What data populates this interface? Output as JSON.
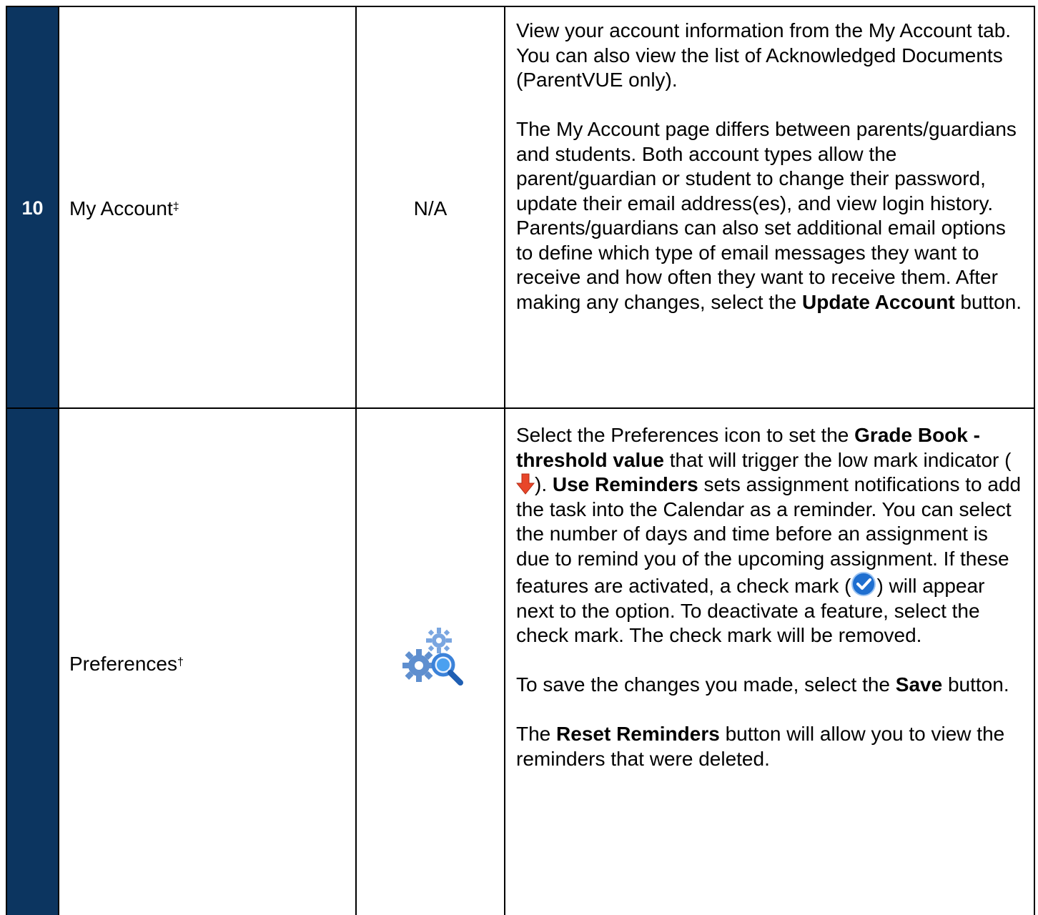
{
  "rows": [
    {
      "number": "10",
      "name": "My Account",
      "name_mark": "‡",
      "icon_text": "N/A",
      "paragraphs": [
        [
          "View your account information from the My Account tab.  You can also view the list of Acknowledged Documents (ParentVUE only)."
        ],
        [
          "The My Account page differs between parents/guardians and students.  Both account types allow the parent/guardian or student to change their password, update their email address(es), and view login history. Parents/guardians can also set additional email options to define which type of email messages they want to receive and how often they want to receive them.  After making any changes, select the ",
          "Update Account",
          " button."
        ]
      ]
    },
    {
      "number": "",
      "name": "Preferences",
      "name_mark": "†",
      "icon": "preferences-gears-magnifier-icon",
      "p1": {
        "t1": "Select the Preferences icon to set the ",
        "b1": "Grade Book - threshold value",
        "t2": " that will trigger the low mark indicator (",
        "low_mark_icon": "red-down-arrow-icon",
        "t3": ").  ",
        "b2": "Use Reminders",
        "t4": " sets assignment notifications to add the task into the Calendar as a reminder. You can select the number of days and time before an assignment is due to remind you of the upcoming assignment. If these features are activated, a check mark (",
        "check_icon": "blue-check-mark-icon",
        "t5": ") will appear next to the option. To deactivate a feature, select the check mark. The check mark will be removed."
      },
      "p2": {
        "t1": "To save the changes you made, select the ",
        "b1": "Save",
        "t2": " button."
      },
      "p3": {
        "t1": "The ",
        "b1": "Reset Reminders",
        "t2": " button will allow you to view the reminders that were deleted."
      }
    }
  ],
  "colors": {
    "number_column_bg": "#0c3560",
    "number_text": "#ffffff",
    "border": "#000000",
    "check_blue": "#1f6fd0",
    "arrow_red": "#e8462a"
  }
}
